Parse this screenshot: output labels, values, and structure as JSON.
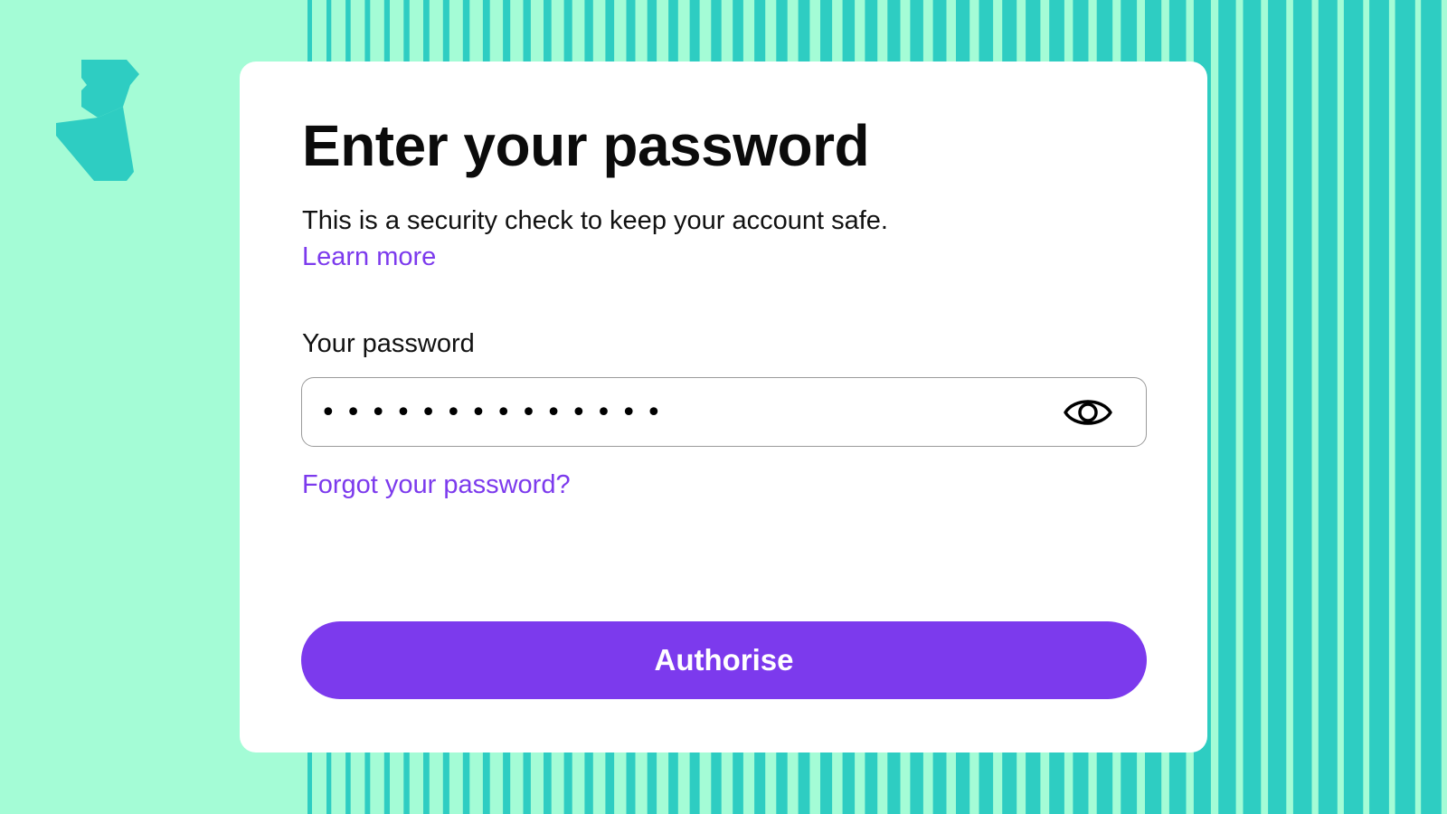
{
  "colors": {
    "background": "#a4fcd6",
    "stripes": "#2ecdc2",
    "accent": "#7c3aed",
    "card": "#ffffff"
  },
  "logo": {
    "icon": "brand-logo-icon"
  },
  "dialog": {
    "title": "Enter your password",
    "subtitle": "This is a security check to keep your account safe.",
    "learn_more": "Learn more",
    "password_label": "Your password",
    "password_value": "••••••••••••••",
    "toggle_icon": "eye-icon",
    "forgot_link": "Forgot your password?",
    "submit_label": "Authorise"
  }
}
